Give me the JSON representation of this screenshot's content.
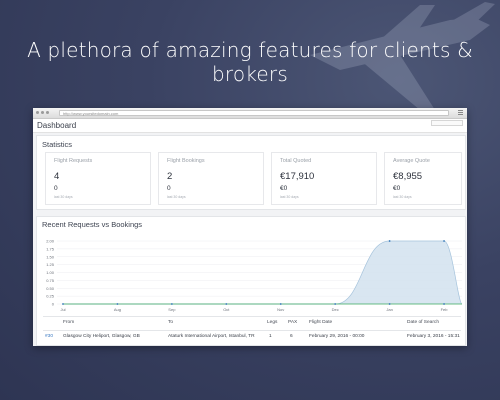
{
  "headline": "A plethora of amazing features for clients & brokers",
  "browser": {
    "url": "http://www.yoursitedomain.com"
  },
  "header": {
    "title": "Dashboard"
  },
  "statistics": {
    "title": "Statistics",
    "cards": [
      {
        "label": "Flight Requests",
        "value": "4",
        "sub": "0",
        "foot": "last 30 days"
      },
      {
        "label": "Flight Bookings",
        "value": "2",
        "sub": "0",
        "foot": "last 30 days"
      },
      {
        "label": "Total Quoted",
        "value": "€17,910",
        "sub": "€0",
        "foot": "last 30 days"
      },
      {
        "label": "Average Quote",
        "value": "€8,955",
        "sub": "€0",
        "foot": "last 30 days"
      }
    ]
  },
  "chart": {
    "title": "Recent Requests vs Bookings"
  },
  "chart_data": {
    "type": "area",
    "title": "Recent Requests vs Bookings",
    "categories": [
      "Jul",
      "Aug",
      "Sep",
      "Oct",
      "Nov",
      "Dec",
      "Jan",
      "Feb"
    ],
    "ylim": [
      0,
      2
    ],
    "yticks": [
      "0",
      "0.25",
      "0.50",
      "0.75",
      "1.00",
      "1.25",
      "1.50",
      "1.75",
      "2.00"
    ],
    "series": [
      {
        "values": [
          0,
          0,
          0,
          0,
          0,
          0,
          2,
          2
        ],
        "color": "#d2e2ef"
      },
      {
        "values": [
          0,
          0,
          0,
          0,
          0,
          0,
          0,
          0
        ],
        "color": "#3aa860"
      }
    ],
    "grid": true
  },
  "table": {
    "headers": [
      "From",
      "To",
      "Legs",
      "PAX",
      "Flight Date",
      "Date of Search"
    ],
    "rows": [
      {
        "id": "#30",
        "from": "Glasgow City Heliport, Glasgow, GB",
        "to": "Ataturk International Airport, Istanbul, TR",
        "legs": "1",
        "pax": "6",
        "flight_date": "February 29, 2016 - 00:00",
        "search_date": "February 3, 2016 - 15:31"
      }
    ]
  },
  "colors": {
    "background": "#3a4262",
    "area_fill": "#d2e2ef",
    "area_stroke": "#a5c3dc",
    "line_green": "#3aa860",
    "link": "#3a79c2"
  }
}
